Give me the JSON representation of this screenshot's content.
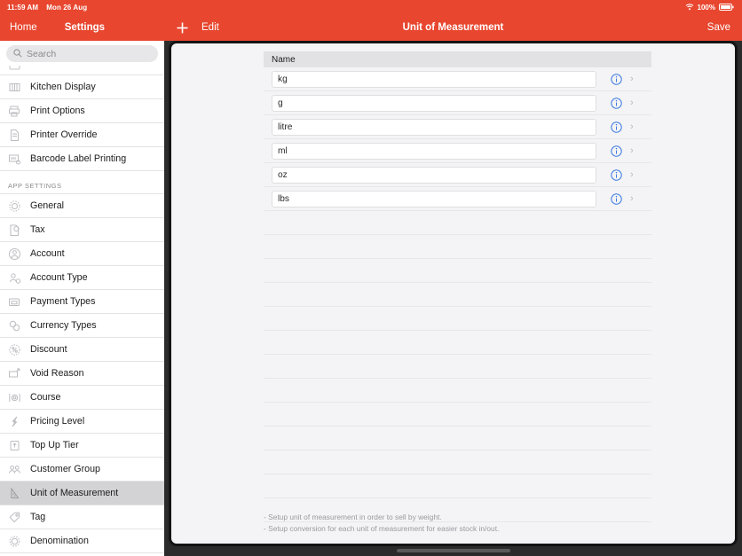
{
  "status_bar": {
    "time": "11:59 AM",
    "date": "Mon 26 Aug",
    "battery_pct": "100%",
    "wifi_icon": "wifi-icon",
    "battery_icon": "battery-icon"
  },
  "sidebar": {
    "back_label": "Home",
    "title": "Settings",
    "search": {
      "placeholder": "Search",
      "value": "",
      "icon": "search-icon"
    },
    "section_header": "APP SETTINGS",
    "items_top": [
      {
        "label": "Kitchen Display",
        "icon": "kitchen-display-icon",
        "selected": false
      },
      {
        "label": "Print Options",
        "icon": "printer-icon",
        "selected": false
      },
      {
        "label": "Printer Override",
        "icon": "document-icon",
        "selected": false
      },
      {
        "label": "Barcode Label Printing",
        "icon": "barcode-icon",
        "selected": false
      }
    ],
    "items_app": [
      {
        "label": "General",
        "icon": "gear-icon",
        "selected": false
      },
      {
        "label": "Tax",
        "icon": "tax-icon",
        "selected": false
      },
      {
        "label": "Account",
        "icon": "account-icon",
        "selected": false
      },
      {
        "label": "Account Type",
        "icon": "account-type-icon",
        "selected": false
      },
      {
        "label": "Payment Types",
        "icon": "payment-icon",
        "selected": false
      },
      {
        "label": "Currency Types",
        "icon": "currency-icon",
        "selected": false
      },
      {
        "label": "Discount",
        "icon": "discount-icon",
        "selected": false
      },
      {
        "label": "Void Reason",
        "icon": "void-reason-icon",
        "selected": false
      },
      {
        "label": "Course",
        "icon": "course-icon",
        "selected": false
      },
      {
        "label": "Pricing Level",
        "icon": "pricing-level-icon",
        "selected": false
      },
      {
        "label": "Top Up Tier",
        "icon": "top-up-tier-icon",
        "selected": false
      },
      {
        "label": "Customer Group",
        "icon": "customer-group-icon",
        "selected": false
      },
      {
        "label": "Unit of Measurement",
        "icon": "unit-of-measurement-icon",
        "selected": true
      },
      {
        "label": "Tag",
        "icon": "tag-icon",
        "selected": false
      },
      {
        "label": "Denomination",
        "icon": "denomination-icon",
        "selected": false
      }
    ]
  },
  "navbar": {
    "add_label": "",
    "add_icon": "plus-icon",
    "edit_label": "Edit",
    "title": "Unit of Measurement",
    "save_label": "Save"
  },
  "table": {
    "column_header": "Name",
    "rows": [
      {
        "name": "kg"
      },
      {
        "name": "g"
      },
      {
        "name": "litre"
      },
      {
        "name": "ml"
      },
      {
        "name": "oz"
      },
      {
        "name": "lbs"
      }
    ],
    "empty_row_count": 13,
    "row_info_icon": "info-icon",
    "row_chevron_icon": "chevron-right-icon"
  },
  "notes": [
    "- Setup unit of measurement in order to sell by weight.",
    "- Setup conversion for each unit of measurement for easier stock in/out."
  ],
  "colors": {
    "brand_red": "#E8462F",
    "info_blue": "#3B7AE0",
    "selected_row": "#D3D3D6",
    "panel_bg": "#F4F4F6"
  }
}
